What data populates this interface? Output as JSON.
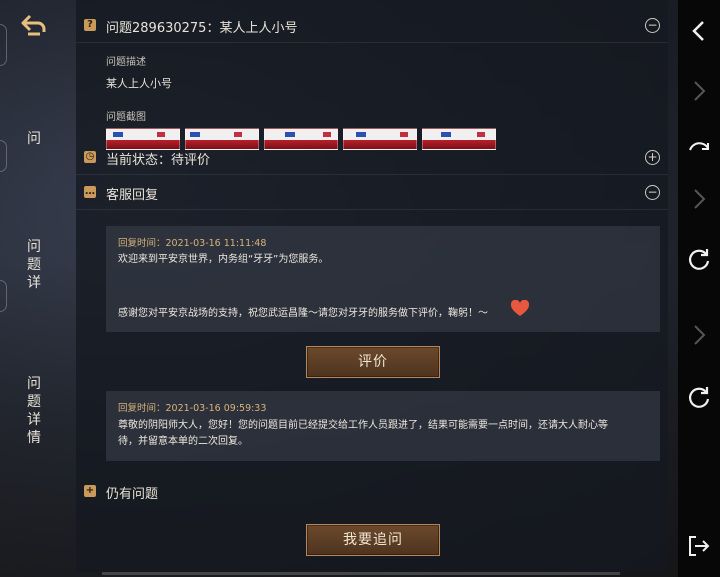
{
  "left_tabs": [
    "问",
    "问\n题\n详",
    "问\n题\n详\n情"
  ],
  "question": {
    "title": "问题289630275：某人上人小号",
    "desc_label": "问题描述",
    "desc_text": "某人上人小号",
    "screenshot_label": "问题截图",
    "screenshot_count": 5
  },
  "status": {
    "title": "当前状态：待评价"
  },
  "service": {
    "title": "客服回复",
    "reply1": {
      "time": "回复时间：2021-03-16 11:11:48",
      "line1": "欢迎来到平安京世界，内务组“牙牙”为您服务。",
      "line2": "感谢您对平安京战场的支持，祝您武运昌隆～请您对牙牙的服务做下评价，鞠躬！～"
    },
    "rate_button": "评价",
    "reply2": {
      "time": "回复时间：2021-03-16 09:59:33",
      "line1": "尊敬的阴阳师大人，您好！您的问题目前已经提交给工作人员跟进了，结果可能需要一点时间，还请大人耐心等",
      "line2": "待，并留意本单的二次回复。"
    }
  },
  "still_issue": {
    "title": "仍有问题"
  },
  "followup_button": "我要追问",
  "icons": {
    "back": "back-arrow-icon",
    "question": "question-mark-icon",
    "status": "clock-icon",
    "service": "chat-bubble-icon",
    "still": "plus-square-icon"
  },
  "colors": {
    "accent": "#c99a5a",
    "button": "#5c3e26",
    "time": "#d8b27a"
  }
}
